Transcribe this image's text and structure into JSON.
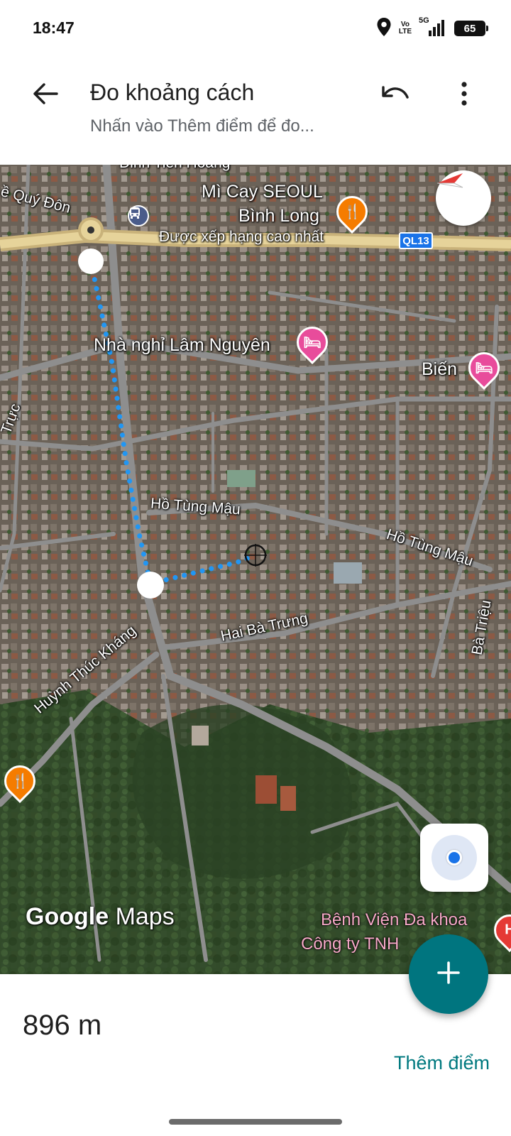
{
  "status_bar": {
    "time": "18:47",
    "volte_top": "Vo",
    "volte_bottom": "LTE",
    "network": "5G",
    "battery": "65",
    "icons": [
      "location-icon",
      "volte-icon",
      "signal-icon",
      "battery-icon"
    ]
  },
  "app_bar": {
    "title": "Đo khoảng cách",
    "subtitle": "Nhấn vào Thêm điểm để đo...",
    "icons": [
      "back-arrow-icon",
      "undo-icon",
      "more-vertical-icon"
    ]
  },
  "map": {
    "roads": [
      {
        "name": "Lê Quý Đôn",
        "text": "ề Quý Đôn"
      },
      {
        "name": "Hồ Tùng Mậu",
        "text": "Hồ Tùng Mậu"
      },
      {
        "name": "Hồ Tùng Mậu 2",
        "text": "Hồ Tùng Mậu"
      },
      {
        "name": "Hai Bà Trưng",
        "text": "Hai Bà Trưng"
      },
      {
        "name": "Huỳnh Thúc Kháng",
        "text": "Huỳnh Thúc Kháng"
      },
      {
        "name": "Bà Triệu",
        "text": "Bà Triệu"
      },
      {
        "name": "Trực",
        "text": "Trực"
      },
      {
        "name": "Đinh Tiên Hoàng",
        "text": "Đinh Tiên Hoàng"
      }
    ],
    "highway_shield": "QL13",
    "pois": {
      "restaurant_name_line1": "Mì Cay SEOUL",
      "restaurant_name_line2": "Bình Long",
      "restaurant_tag": "Được xếp hạng cao nhất",
      "hotel_name": "Nhà nghỉ Lâm Nguyên",
      "hotel2_name": "Biến",
      "hospital_line1": "Bệnh Viện Đa khoa",
      "hospital_line2": "Công ty TNH"
    },
    "watermark_google": "Google",
    "watermark_maps": "Maps",
    "measure_line_color": "#2196f3",
    "map_icons": [
      "bus-stop-icon",
      "restaurant-icon",
      "hotel-icon",
      "hospital-icon",
      "compass-icon",
      "my-location-icon"
    ]
  },
  "measurement": {
    "distance": "896 m",
    "add_point_label": "Thêm điểm",
    "add_icon": "plus-icon",
    "accent_color": "#00757f"
  }
}
